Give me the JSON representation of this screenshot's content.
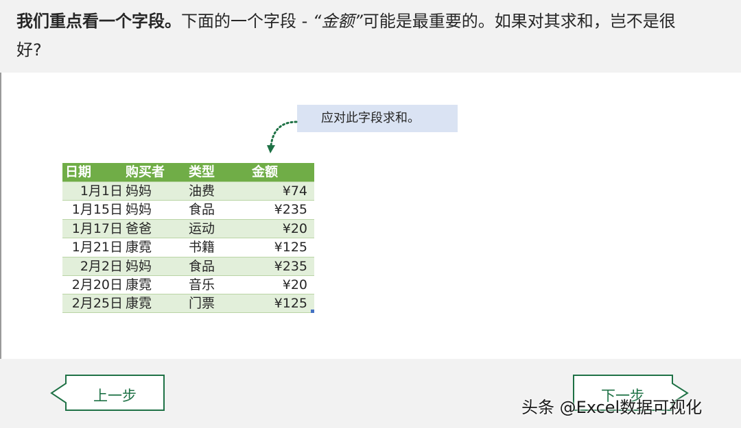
{
  "header": {
    "bold_part": "我们重点看一个字段。",
    "text_part": "下面的一个字段 - ",
    "field_quoted": "“金额”",
    "rest_line1": "可能是最重要的。如果对其求和，岂不是很",
    "rest_line2": "好?"
  },
  "callout": {
    "text": "应对此字段求和。"
  },
  "table": {
    "columns": [
      "日期",
      "购买者",
      "类型",
      "金额"
    ],
    "rows": [
      {
        "date": "1月1日",
        "buyer": "妈妈",
        "type": "油费",
        "amount": "¥74"
      },
      {
        "date": "1月15日",
        "buyer": "妈妈",
        "type": "食品",
        "amount": "¥235"
      },
      {
        "date": "1月17日",
        "buyer": "爸爸",
        "type": "运动",
        "amount": "¥20"
      },
      {
        "date": "1月21日",
        "buyer": "康霓",
        "type": "书籍",
        "amount": "¥125"
      },
      {
        "date": "2月2日",
        "buyer": "妈妈",
        "type": "食品",
        "amount": "¥235"
      },
      {
        "date": "2月20日",
        "buyer": "康霓",
        "type": "音乐",
        "amount": "¥20"
      },
      {
        "date": "2月25日",
        "buyer": "康霓",
        "type": "门票",
        "amount": "¥125"
      }
    ]
  },
  "nav": {
    "prev_label": "上一步",
    "next_label": "下一步"
  },
  "watermark": {
    "text": "头条 @Excel数据可视化"
  },
  "colors": {
    "header_bg": "#f2f2f2",
    "table_header": "#70ad47",
    "table_band": "#e2efda",
    "callout_bg": "#dae3f3",
    "nav_green": "#1e7145"
  }
}
